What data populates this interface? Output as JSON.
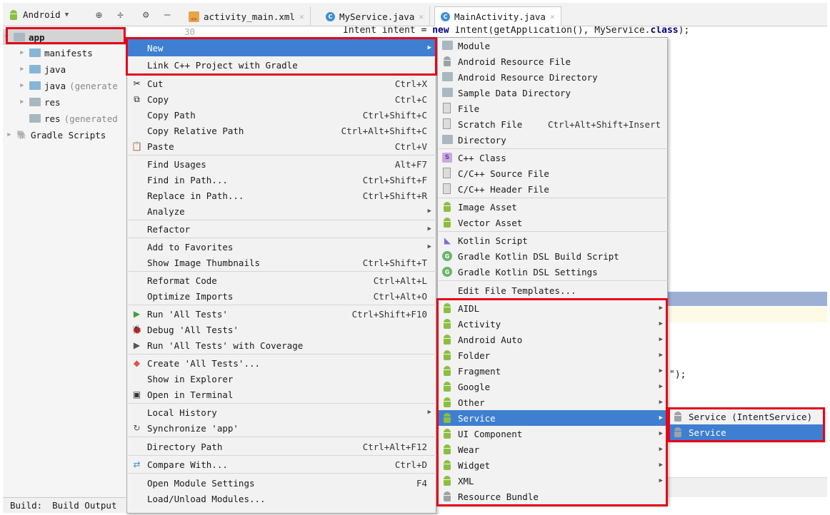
{
  "toolbar": {
    "project_view": "Android",
    "tabs": [
      {
        "label": "activity_main.xml"
      },
      {
        "label": "MyService.java"
      },
      {
        "label": "MainActivity.java"
      }
    ]
  },
  "editor": {
    "line_number": "30",
    "code_prefix": "Intent intent = ",
    "code_kw_new": "new",
    "code_mid": " Intent(getApplication(), MyService.",
    "code_kw_class": "class",
    "code_end": ");",
    "fragment": "\");"
  },
  "tree": {
    "items": [
      {
        "label": "app"
      },
      {
        "label": "manifests"
      },
      {
        "label": "java"
      },
      {
        "label": "java",
        "suffix": "(generate"
      },
      {
        "label": "res"
      },
      {
        "label": "res",
        "suffix": "(generated"
      },
      {
        "label": "Gradle Scripts"
      }
    ]
  },
  "bottom": {
    "build": "Build:",
    "build_output": "Build Output"
  },
  "context_menu": {
    "items": [
      {
        "label": "New",
        "shortcut": ""
      },
      {
        "label": "Link C++ Project with Gradle",
        "shortcut": ""
      },
      {
        "label": "Cut",
        "shortcut": "Ctrl+X"
      },
      {
        "label": "Copy",
        "shortcut": "Ctrl+C"
      },
      {
        "label": "Copy Path",
        "shortcut": "Ctrl+Shift+C"
      },
      {
        "label": "Copy Relative Path",
        "shortcut": "Ctrl+Alt+Shift+C"
      },
      {
        "label": "Paste",
        "shortcut": "Ctrl+V"
      },
      {
        "label": "Find Usages",
        "shortcut": "Alt+F7"
      },
      {
        "label": "Find in Path...",
        "shortcut": "Ctrl+Shift+F"
      },
      {
        "label": "Replace in Path...",
        "shortcut": "Ctrl+Shift+R"
      },
      {
        "label": "Analyze",
        "shortcut": ""
      },
      {
        "label": "Refactor",
        "shortcut": ""
      },
      {
        "label": "Add to Favorites",
        "shortcut": ""
      },
      {
        "label": "Show Image Thumbnails",
        "shortcut": "Ctrl+Shift+T"
      },
      {
        "label": "Reformat Code",
        "shortcut": "Ctrl+Alt+L"
      },
      {
        "label": "Optimize Imports",
        "shortcut": "Ctrl+Alt+O"
      },
      {
        "label": "Run 'All Tests'",
        "shortcut": "Ctrl+Shift+F10"
      },
      {
        "label": "Debug 'All Tests'",
        "shortcut": ""
      },
      {
        "label": "Run 'All Tests' with Coverage",
        "shortcut": ""
      },
      {
        "label": "Create 'All Tests'...",
        "shortcut": ""
      },
      {
        "label": "Show in Explorer",
        "shortcut": ""
      },
      {
        "label": "Open in Terminal",
        "shortcut": ""
      },
      {
        "label": "Local History",
        "shortcut": ""
      },
      {
        "label": "Synchronize 'app'",
        "shortcut": ""
      },
      {
        "label": "Directory Path",
        "shortcut": "Ctrl+Alt+F12"
      },
      {
        "label": "Compare With...",
        "shortcut": "Ctrl+D"
      },
      {
        "label": "Open Module Settings",
        "shortcut": "F4"
      },
      {
        "label": "Load/Unload Modules...",
        "shortcut": ""
      }
    ]
  },
  "new_menu": {
    "items": [
      {
        "label": "Module",
        "shortcut": ""
      },
      {
        "label": "Android Resource File",
        "shortcut": ""
      },
      {
        "label": "Android Resource Directory",
        "shortcut": ""
      },
      {
        "label": "Sample Data Directory",
        "shortcut": ""
      },
      {
        "label": "File",
        "shortcut": ""
      },
      {
        "label": "Scratch File",
        "shortcut": "Ctrl+Alt+Shift+Insert"
      },
      {
        "label": "Directory",
        "shortcut": ""
      },
      {
        "label": "C++ Class",
        "shortcut": ""
      },
      {
        "label": "C/C++ Source File",
        "shortcut": ""
      },
      {
        "label": "C/C++ Header File",
        "shortcut": ""
      },
      {
        "label": "Image Asset",
        "shortcut": ""
      },
      {
        "label": "Vector Asset",
        "shortcut": ""
      },
      {
        "label": "Kotlin Script",
        "shortcut": ""
      },
      {
        "label": "Gradle Kotlin DSL Build Script",
        "shortcut": ""
      },
      {
        "label": "Gradle Kotlin DSL Settings",
        "shortcut": ""
      },
      {
        "label": "Edit File Templates...",
        "shortcut": ""
      },
      {
        "label": "AIDL",
        "shortcut": ""
      },
      {
        "label": "Activity",
        "shortcut": ""
      },
      {
        "label": "Android Auto",
        "shortcut": ""
      },
      {
        "label": "Folder",
        "shortcut": ""
      },
      {
        "label": "Fragment",
        "shortcut": ""
      },
      {
        "label": "Google",
        "shortcut": ""
      },
      {
        "label": "Other",
        "shortcut": ""
      },
      {
        "label": "Service",
        "shortcut": ""
      },
      {
        "label": "UI Component",
        "shortcut": ""
      },
      {
        "label": "Wear",
        "shortcut": ""
      },
      {
        "label": "Widget",
        "shortcut": ""
      },
      {
        "label": "XML",
        "shortcut": ""
      },
      {
        "label": "Resource Bundle",
        "shortcut": ""
      }
    ]
  },
  "service_menu": {
    "items": [
      {
        "label": "Service (IntentService)"
      },
      {
        "label": "Service"
      }
    ]
  },
  "colors": {
    "highlight": "#3f7fd1",
    "annotation": "#e3051b",
    "android": "#8cbf3f"
  }
}
